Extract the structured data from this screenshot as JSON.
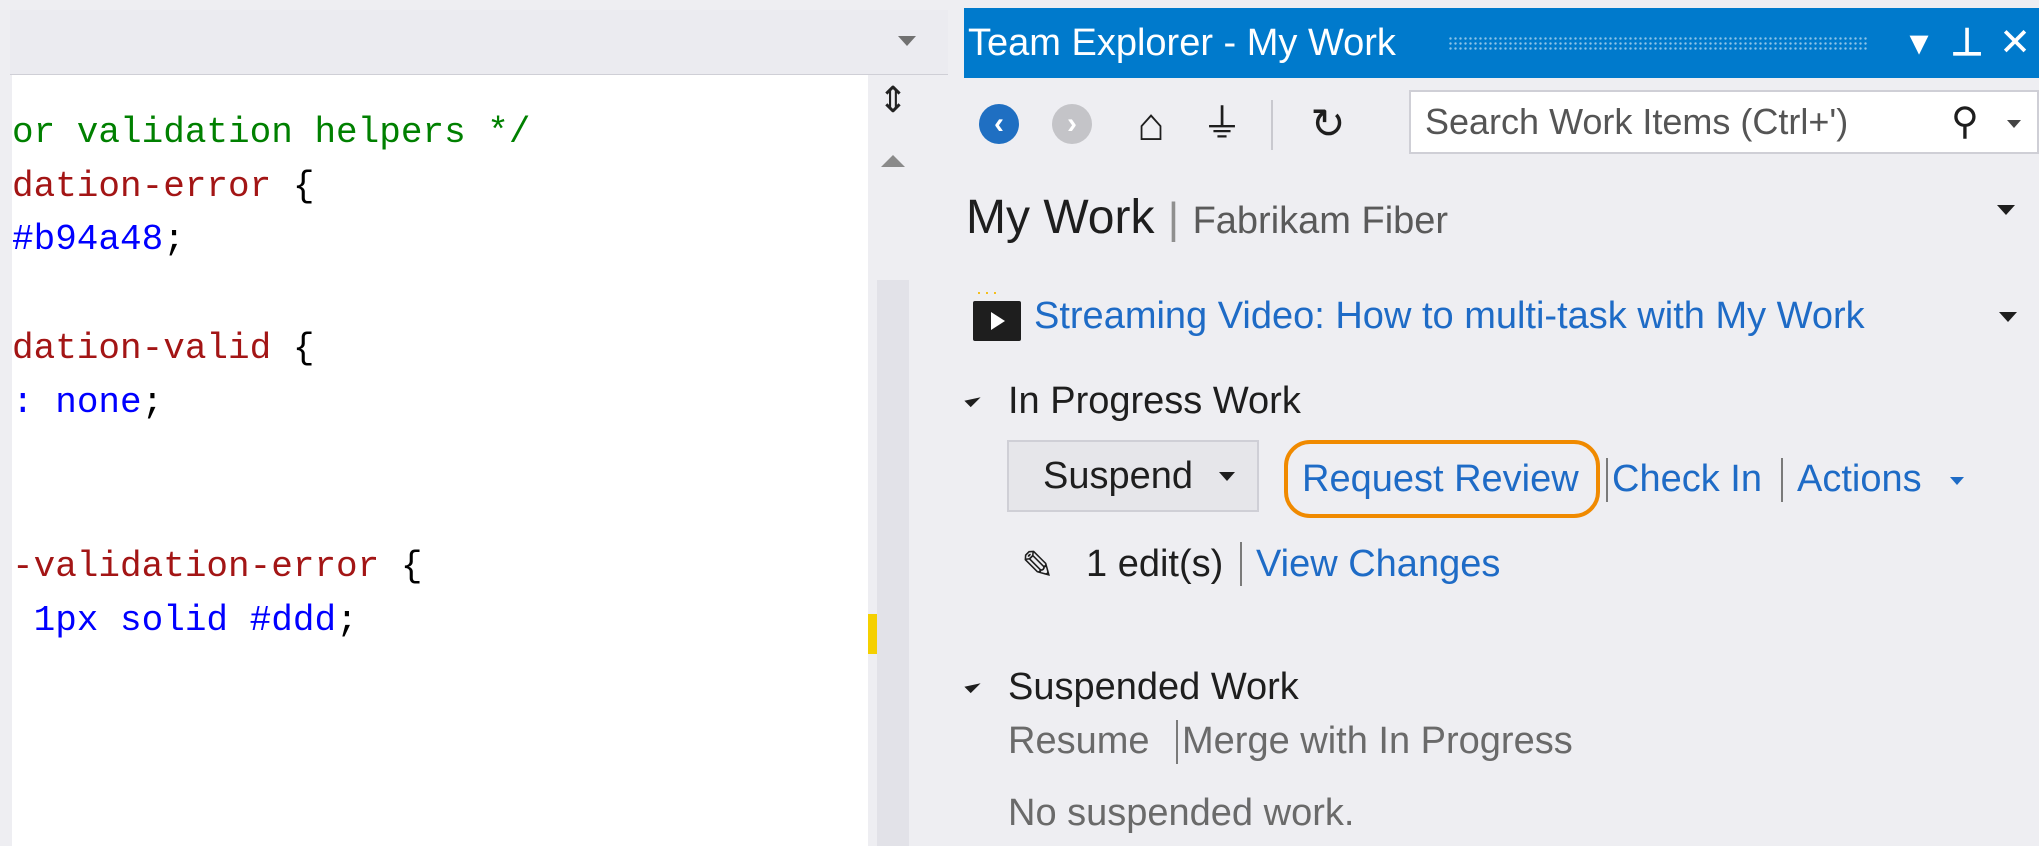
{
  "editor": {
    "lines": [
      {
        "parts": [
          {
            "text": "or validation helpers */",
            "cls": "tok-comment"
          }
        ]
      },
      {
        "parts": [
          {
            "text": "dation-error",
            "cls": "tok-selector"
          },
          {
            "text": " {",
            "cls": "tok-plain"
          }
        ]
      },
      {
        "parts": [
          {
            "text": "#b94a48",
            "cls": "tok-value"
          },
          {
            "text": ";",
            "cls": "tok-plain"
          }
        ]
      },
      {
        "parts": [
          {
            "text": "dation-valid",
            "cls": "tok-selector"
          },
          {
            "text": " {",
            "cls": "tok-plain"
          }
        ]
      },
      {
        "parts": [
          {
            "text": ": ",
            "cls": "tok-value"
          },
          {
            "text": "none",
            "cls": "tok-value"
          },
          {
            "text": ";",
            "cls": "tok-plain"
          }
        ]
      },
      {
        "parts": [
          {
            "text": "-validation-error",
            "cls": "tok-selector"
          },
          {
            "text": " {",
            "cls": "tok-plain"
          }
        ]
      },
      {
        "parts": [
          {
            "text": " 1px solid #ddd",
            "cls": "tok-value"
          },
          {
            "text": ";",
            "cls": "tok-plain"
          }
        ]
      }
    ]
  },
  "team_explorer": {
    "title": "Team Explorer - My Work",
    "title_buttons": {
      "dropdown": "▾",
      "pin": "⊥",
      "close": "✕"
    },
    "toolbar": {
      "back_icon": "arrow-left",
      "forward_icon": "arrow-right",
      "home_icon": "home",
      "connect_icon": "plug",
      "refresh_icon": "refresh",
      "search_placeholder": "Search Work Items (Ctrl+')"
    },
    "page": {
      "title": "My Work",
      "separator": "|",
      "project": "Fabrikam Fiber"
    },
    "video_link": "Streaming Video: How to multi-task with My Work",
    "in_progress": {
      "heading": "In Progress Work",
      "suspend_label": "Suspend",
      "request_review": "Request Review",
      "check_in": "Check In",
      "actions": "Actions",
      "edits": "1 edit(s)",
      "view_changes": "View Changes"
    },
    "suspended": {
      "heading": "Suspended Work",
      "resume": "Resume",
      "merge": "Merge with In Progress",
      "empty_message": "No suspended work."
    },
    "colors": {
      "title_bar": "#007acc",
      "link": "#1e6bc6",
      "highlight": "#f08a00"
    }
  }
}
